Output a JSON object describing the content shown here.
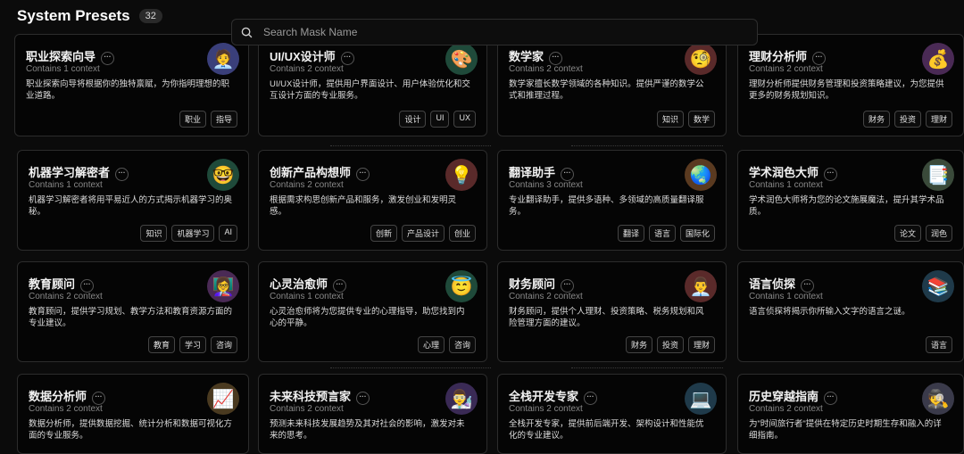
{
  "header": {
    "title": "System Presets",
    "count": "32"
  },
  "search": {
    "placeholder": "Search Mask Name",
    "icon": "search-icon"
  },
  "cards": [
    {
      "title": "职业探索向导",
      "sub": "Contains 1 context",
      "desc": "职业探索向导将根据你的独特禀赋，为你指明理想的职业道路。",
      "tags": [
        "职业",
        "指导"
      ],
      "emoji": "🧑‍💼",
      "icon": "career-advisor-icon",
      "bg": "#3a3f7a"
    },
    {
      "title": "UI/UX设计师",
      "sub": "Contains 2 context",
      "desc": "UI/UX设计师，提供用户界面设计、用户体验优化和交互设计方面的专业服务。",
      "tags": [
        "设计",
        "UI",
        "UX"
      ],
      "emoji": "🎨",
      "icon": "palette-icon",
      "bg": "#1f4a3a"
    },
    {
      "title": "数学家",
      "sub": "Contains 2 context",
      "desc": "数学家擅长数学领域的各种知识。提供严谨的数学公式和推理过程。",
      "tags": [
        "知识",
        "数学"
      ],
      "emoji": "🧐",
      "icon": "monocle-face-icon",
      "bg": "#5a2a2a"
    },
    {
      "title": "理财分析师",
      "sub": "Contains 2 context",
      "desc": "理财分析师提供财务管理和投资策略建议，为您提供更多的财务规划知识。",
      "tags": [
        "财务",
        "投资",
        "理财"
      ],
      "emoji": "💰",
      "icon": "money-bag-icon",
      "bg": "#4a2a55"
    },
    {
      "title": "机器学习解密者",
      "sub": "Contains 1 context",
      "desc": "机器学习解密者将用平易近人的方式揭示机器学习的奥秘。",
      "tags": [
        "知识",
        "机器学习",
        "AI"
      ],
      "emoji": "🤓",
      "icon": "nerd-face-icon",
      "bg": "#1f4a3a"
    },
    {
      "title": "创新产品构想师",
      "sub": "Contains 2 context",
      "desc": "根据需求构思创新产品和服务，激发创业和发明灵感。",
      "tags": [
        "创新",
        "产品设计",
        "创业"
      ],
      "emoji": "💡",
      "icon": "light-bulb-icon",
      "bg": "#5a2a2a"
    },
    {
      "title": "翻译助手",
      "sub": "Contains 3 context",
      "desc": "专业翻译助手，提供多语种、多领域的高质量翻译服务。",
      "tags": [
        "翻译",
        "语言",
        "国际化"
      ],
      "emoji": "🌏",
      "icon": "globe-icon",
      "bg": "#5a3a20"
    },
    {
      "title": "学术润色大师",
      "sub": "Contains 1 context",
      "desc": "学术润色大师将为您的论文施展魔法，提升其学术品质。",
      "tags": [
        "论文",
        "润色"
      ],
      "emoji": "📑",
      "icon": "document-icon",
      "bg": "#3a4a3a"
    },
    {
      "title": "教育顾问",
      "sub": "Contains 2 context",
      "desc": "教育顾问，提供学习规划、教学方法和教育资源方面的专业建议。",
      "tags": [
        "教育",
        "学习",
        "咨询"
      ],
      "emoji": "👩‍🏫",
      "icon": "teacher-icon",
      "bg": "#4a2a55"
    },
    {
      "title": "心灵治愈师",
      "sub": "Contains 1 context",
      "desc": "心灵治愈师将为您提供专业的心理指导，助您找到内心的平静。",
      "tags": [
        "心理",
        "咨询"
      ],
      "emoji": "😇",
      "icon": "angel-face-icon",
      "bg": "#1f4a3a"
    },
    {
      "title": "财务顾问",
      "sub": "Contains 2 context",
      "desc": "财务顾问，提供个人理财、投资策略、税务规划和风险管理方面的建议。",
      "tags": [
        "财务",
        "投资",
        "理财"
      ],
      "emoji": "👨‍💼",
      "icon": "office-worker-icon",
      "bg": "#5a2a2a"
    },
    {
      "title": "语言侦探",
      "sub": "Contains 1 context",
      "desc": "语言侦探将揭示你所输入文字的语言之谜。",
      "tags": [
        "语言"
      ],
      "emoji": "📚",
      "icon": "books-icon",
      "bg": "#1f3a4a"
    },
    {
      "title": "数据分析师",
      "sub": "Contains 2 context",
      "desc": "数据分析师，提供数据挖掘、统计分析和数据可视化方面的专业服务。",
      "tags": [],
      "emoji": "📈",
      "icon": "chart-increasing-icon",
      "bg": "#4a3a20"
    },
    {
      "title": "未来科技预言家",
      "sub": "Contains 2 context",
      "desc": "预测未来科技发展趋势及其对社会的影响，激发对未来的思考。",
      "tags": [],
      "emoji": "👨‍🔬",
      "icon": "scientist-icon",
      "bg": "#3a2a55"
    },
    {
      "title": "全栈开发专家",
      "sub": "Contains 2 context",
      "desc": "全栈开发专家，提供前后端开发、架构设计和性能优化的专业建议。",
      "tags": [],
      "emoji": "💻",
      "icon": "laptop-icon",
      "bg": "#1f3a4a"
    },
    {
      "title": "历史穿越指南",
      "sub": "Contains 2 context",
      "desc": "为\"时间旅行者\"提供在特定历史时期生存和融入的详细指南。",
      "tags": [],
      "emoji": "🕵️",
      "icon": "detective-icon",
      "bg": "#3a3a4a"
    }
  ]
}
